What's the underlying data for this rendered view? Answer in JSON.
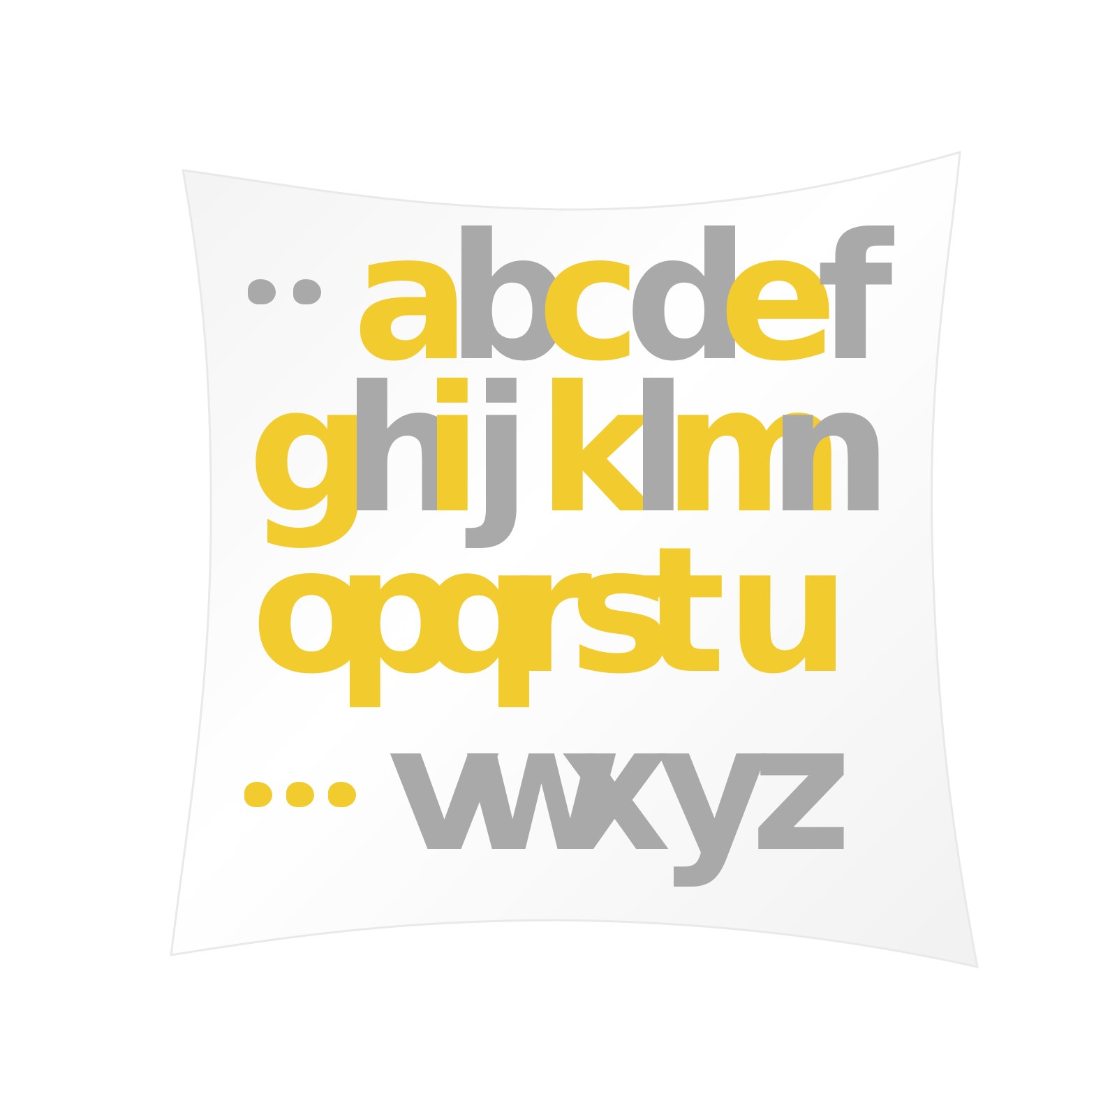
{
  "image": {
    "subject": "throw pillow cover",
    "background_color": "#ffffff",
    "pillow_color": "#f6f6f6",
    "colors": {
      "yellow": "#f2cc2e",
      "gray": "#a9a9a9"
    }
  },
  "rows": [
    {
      "prefix_dots": {
        "count": 2,
        "color": "gray"
      },
      "letters": [
        {
          "char": "a",
          "color": "yellow"
        },
        {
          "char": "b",
          "color": "gray"
        },
        {
          "char": "c",
          "color": "yellow"
        },
        {
          "char": "d",
          "color": "gray"
        },
        {
          "char": "e",
          "color": "yellow"
        },
        {
          "char": "f",
          "color": "gray"
        }
      ]
    },
    {
      "letters": [
        {
          "char": "g",
          "color": "yellow"
        },
        {
          "char": "h",
          "color": "gray"
        },
        {
          "char": "i",
          "color": "yellow"
        },
        {
          "char": "j",
          "color": "gray"
        },
        {
          "char": "k",
          "color": "yellow"
        },
        {
          "char": "l",
          "color": "gray"
        },
        {
          "char": "m",
          "color": "yellow"
        },
        {
          "char": "n",
          "color": "gray"
        }
      ]
    },
    {
      "letters": [
        {
          "char": "o",
          "color": "yellow"
        },
        {
          "char": "p",
          "color": "yellow"
        },
        {
          "char": "q",
          "color": "yellow"
        },
        {
          "char": "r",
          "color": "yellow"
        },
        {
          "char": "s",
          "color": "yellow"
        },
        {
          "char": "t",
          "color": "yellow"
        },
        {
          "char": "u",
          "color": "yellow"
        }
      ]
    },
    {
      "prefix_dots": {
        "count": 3,
        "color": "yellow"
      },
      "letters": [
        {
          "char": "v",
          "color": "gray"
        },
        {
          "char": "w",
          "color": "gray"
        },
        {
          "char": "x",
          "color": "gray"
        },
        {
          "char": "y",
          "color": "gray"
        },
        {
          "char": "z",
          "color": "gray"
        }
      ]
    }
  ]
}
